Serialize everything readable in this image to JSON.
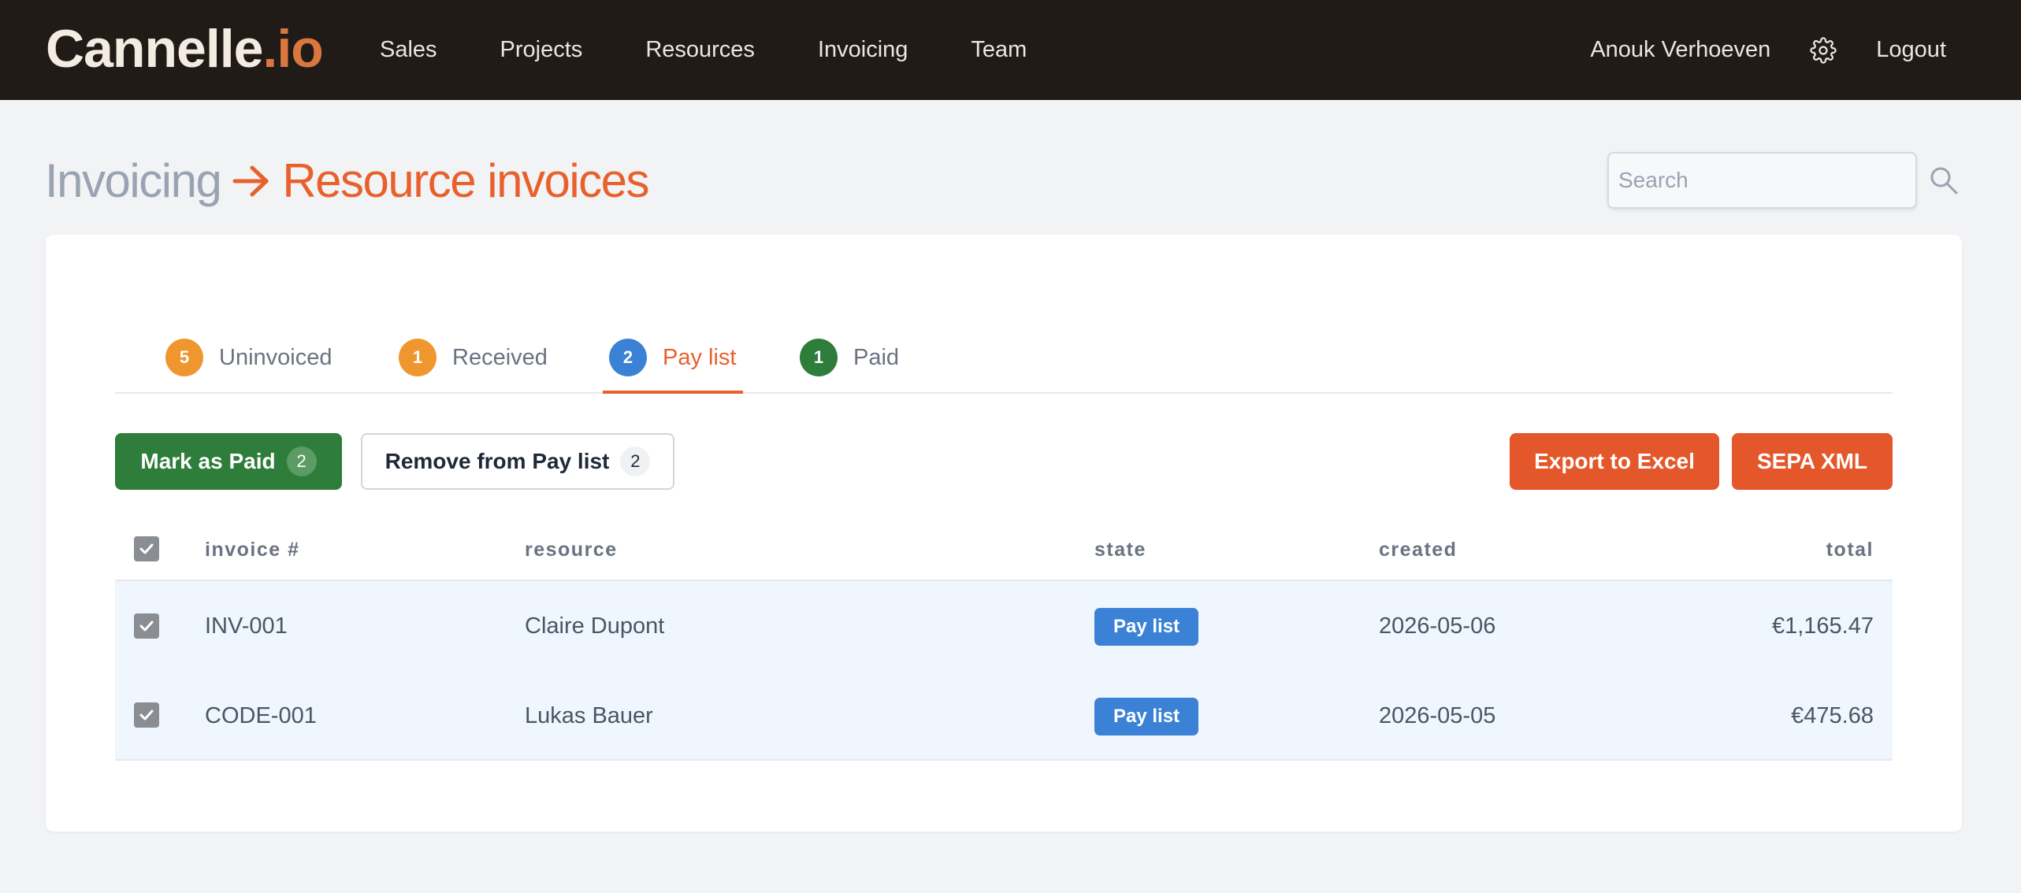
{
  "app": {
    "logo_main": "Cannelle",
    "logo_suffix": ".io"
  },
  "nav": {
    "items": [
      "Sales",
      "Projects",
      "Resources",
      "Invoicing",
      "Team"
    ],
    "user": "Anouk Verhoeven",
    "logout": "Logout",
    "settings_icon": "gear-icon"
  },
  "page": {
    "breadcrumb_parent": "Invoicing",
    "breadcrumb_current": "Resource invoices",
    "search_placeholder": "Search"
  },
  "tabs": [
    {
      "label": "Uninvoiced",
      "count": "5",
      "color": "#f0962f",
      "active": false
    },
    {
      "label": "Received",
      "count": "1",
      "color": "#f0962f",
      "active": false
    },
    {
      "label": "Pay list",
      "count": "2",
      "color": "#3b82d6",
      "active": true
    },
    {
      "label": "Paid",
      "count": "1",
      "color": "#2e7d3a",
      "active": false
    }
  ],
  "actions": {
    "mark_paid_label": "Mark as Paid",
    "mark_paid_count": "2",
    "remove_label": "Remove from Pay list",
    "remove_count": "2",
    "export_label": "Export to Excel",
    "sepa_label": "SEPA XML"
  },
  "table": {
    "columns": [
      "invoice #",
      "resource",
      "state",
      "created",
      "total"
    ],
    "rows": [
      {
        "checked": true,
        "invoice": "INV-001",
        "resource": "Claire Dupont",
        "state": "Pay list",
        "created": "2026-05-06",
        "total": "€1,165.47"
      },
      {
        "checked": true,
        "invoice": "CODE-001",
        "resource": "Lukas Bauer",
        "state": "Pay list",
        "created": "2026-05-05",
        "total": "€475.68"
      }
    ]
  },
  "colors": {
    "accent": "#e8612c",
    "topbar": "#201b17",
    "paid_green": "#2e7d3a",
    "state_blue": "#3b82d6"
  }
}
